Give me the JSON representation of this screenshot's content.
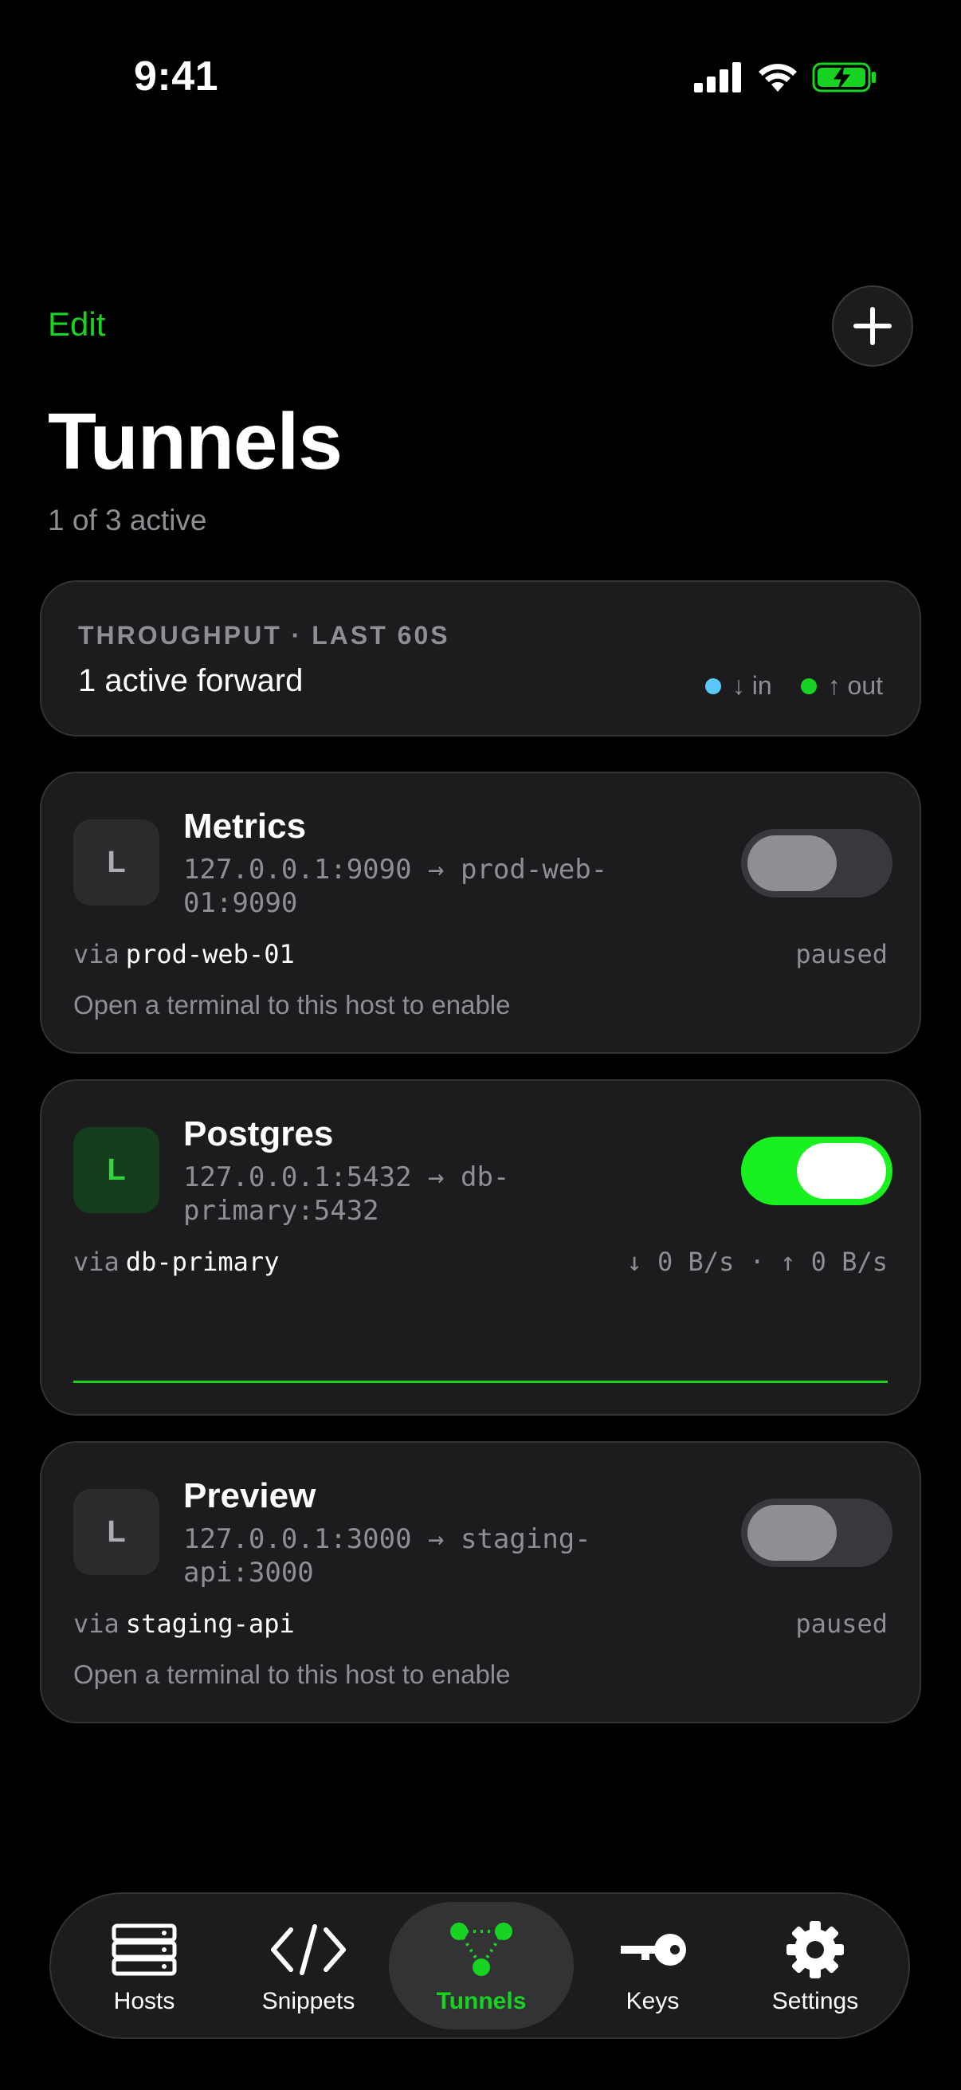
{
  "status_bar": {
    "time": "9:41"
  },
  "header": {
    "edit_label": "Edit",
    "add_icon": "plus-icon",
    "title": "Tunnels",
    "subtitle": "1 of 3 active"
  },
  "throughput": {
    "label": "THROUGHPUT · LAST 60S",
    "summary": "1 active forward",
    "legend": [
      {
        "label": "↓ in",
        "color": "#5ac8fa"
      },
      {
        "label": "↑ out",
        "color": "#19d323"
      }
    ]
  },
  "tunnels": [
    {
      "badge": "L",
      "name": "Metrics",
      "route": "127.0.0.1:9090 → prod-web-01:9090",
      "via_label": "via",
      "host": "prod-web-01",
      "state": "paused",
      "hint": "Open a terminal to this host to enable",
      "enabled": false
    },
    {
      "badge": "L",
      "name": "Postgres",
      "route": "127.0.0.1:5432 → db-primary:5432",
      "via_label": "via",
      "host": "db-primary",
      "state": "↓ 0 B/s · ↑ 0 B/s",
      "hint": "",
      "enabled": true
    },
    {
      "badge": "L",
      "name": "Preview",
      "route": "127.0.0.1:3000 → staging-api:3000",
      "via_label": "via",
      "host": "staging-api",
      "state": "paused",
      "hint": "Open a terminal to this host to enable",
      "enabled": false
    }
  ],
  "tabbar": [
    {
      "label": "Hosts",
      "icon": "server-icon",
      "active": false
    },
    {
      "label": "Snippets",
      "icon": "code-icon",
      "active": false
    },
    {
      "label": "Tunnels",
      "icon": "tunnel-network-icon",
      "active": true
    },
    {
      "label": "Keys",
      "icon": "key-icon",
      "active": false
    },
    {
      "label": "Settings",
      "icon": "gear-icon",
      "active": false
    }
  ],
  "colors": {
    "accent": "#19d323",
    "toggle_on": "#19f020",
    "card": "#1c1c1e",
    "muted": "#8e8e93"
  }
}
